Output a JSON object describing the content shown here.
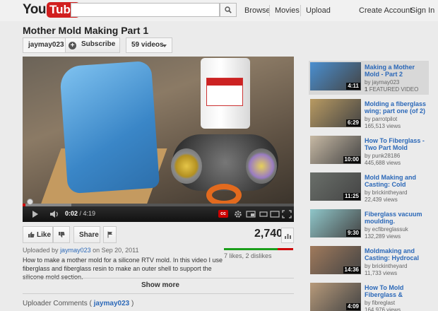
{
  "header": {
    "logo_you": "You",
    "logo_tube": "Tube",
    "search_placeholder": "",
    "nav": [
      "Browse",
      "Movies",
      "Upload"
    ],
    "create_account": "Create Account",
    "sign_in": "Sign In"
  },
  "video": {
    "title": "Mother Mold Making Part 1",
    "owner": "jaymay023",
    "subscribe": "Subscribe",
    "videos_count": "59 videos",
    "current_time": "0:02",
    "duration": "4:19",
    "cc_label": "cc",
    "progress_played": 0.01,
    "progress_loaded": 0.18
  },
  "actions": {
    "like": "Like",
    "share": "Share",
    "view_count": "2,740",
    "likes_text": "7 likes, 2 dislikes",
    "like_ratio": 0.78
  },
  "upload_info": {
    "prefix": "Uploaded by",
    "uploader": "jaymay023",
    "on": "on",
    "date": "Sep 20, 2011"
  },
  "description": "How to make a mother mold for a silicone RTV mold. In this video I use fiberglass and fiberglass resin to make an outer shell to support the silicone mold section.",
  "show_more": "Show more",
  "uploader_comments": {
    "label": "Uploader Comments (",
    "user": "jaymay023",
    "close": ")"
  },
  "related": [
    {
      "title": "Making a Mother Mold - Part 2",
      "meta1": "by jaymay023",
      "meta2": "FEATURED VIDEO",
      "meta2_prefix": "1",
      "duration": "4:11",
      "featured": true,
      "thumb_color": "#4a8fd0"
    },
    {
      "title": "Molding a fiberglass wing; part one (of 2)",
      "meta1": "by parrotpilot",
      "meta2": "165,513 views",
      "duration": "6:29",
      "thumb_color": "#b89a62"
    },
    {
      "title": "How To Fiberglass - Two Part Mold",
      "meta1": "by punk28186",
      "meta2": "445,688 views",
      "duration": "10:00",
      "thumb_color": "#c7b9a4"
    },
    {
      "title": "Mold Making and Casting: Cold",
      "meta1": "by brickintheyard",
      "meta2": "22,439 views",
      "duration": "11:25",
      "thumb_color": "#6a6f6a"
    },
    {
      "title": "Fiberglass vacuum moulding.",
      "meta1": "by ecfibreglassuk",
      "meta2": "132,289 views",
      "duration": "9:30",
      "thumb_color": "#8fc6c9"
    },
    {
      "title": "Moldmaking and Casting: Hydrocal",
      "meta1": "by brickintheyard",
      "meta2": "11,733 views",
      "duration": "14:36",
      "thumb_color": "#a07a5c"
    },
    {
      "title": "How To Mold Fiberglass &",
      "meta1": "by fibreglast",
      "meta2": "164,976 views",
      "duration": "4:09",
      "thumb_color": "#b79a7a"
    }
  ]
}
